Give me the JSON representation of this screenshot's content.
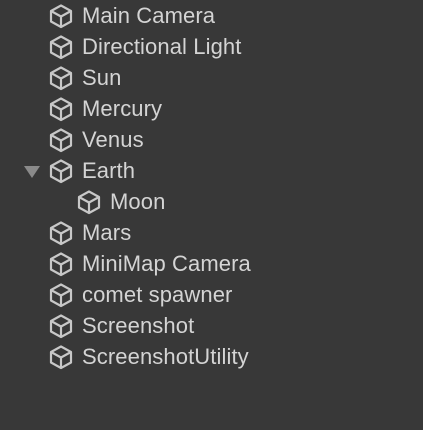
{
  "hierarchy": {
    "items": [
      {
        "label": "Main Camera",
        "depth": 0,
        "expandable": false,
        "icon": "gameobject-cube-icon"
      },
      {
        "label": "Directional Light",
        "depth": 0,
        "expandable": false,
        "icon": "gameobject-cube-icon"
      },
      {
        "label": "Sun",
        "depth": 0,
        "expandable": false,
        "icon": "gameobject-cube-icon"
      },
      {
        "label": "Mercury",
        "depth": 0,
        "expandable": false,
        "icon": "gameobject-cube-icon"
      },
      {
        "label": "Venus",
        "depth": 0,
        "expandable": false,
        "icon": "gameobject-cube-icon"
      },
      {
        "label": "Earth",
        "depth": 0,
        "expandable": true,
        "expanded": true,
        "icon": "gameobject-cube-icon"
      },
      {
        "label": "Moon",
        "depth": 1,
        "expandable": false,
        "icon": "gameobject-cube-icon"
      },
      {
        "label": "Mars",
        "depth": 0,
        "expandable": false,
        "icon": "gameobject-cube-icon"
      },
      {
        "label": "MiniMap Camera",
        "depth": 0,
        "expandable": false,
        "icon": "gameobject-cube-icon"
      },
      {
        "label": "comet spawner",
        "depth": 0,
        "expandable": false,
        "icon": "gameobject-cube-icon"
      },
      {
        "label": "Screenshot",
        "depth": 0,
        "expandable": false,
        "icon": "gameobject-cube-icon"
      },
      {
        "label": "ScreenshotUtility",
        "depth": 0,
        "expandable": false,
        "icon": "gameobject-cube-icon"
      }
    ]
  },
  "colors": {
    "background": "#383838",
    "text": "#d4d4d4",
    "icon": "#c8c8c8",
    "foldout_arrow": "#8a8a8a"
  }
}
